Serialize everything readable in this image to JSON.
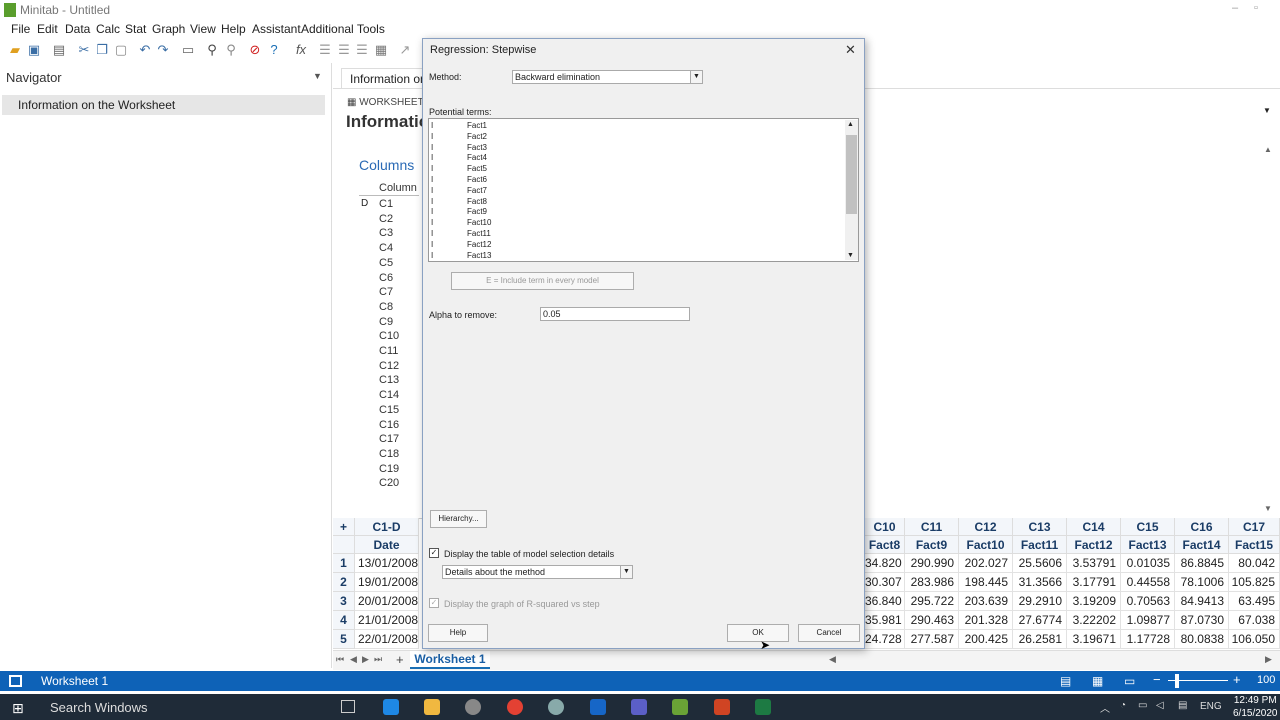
{
  "window": {
    "title": "Minitab - Untitled",
    "min": "–",
    "max": "▫"
  },
  "menu": [
    "File",
    "Edit",
    "Data",
    "Calc",
    "Stat",
    "Graph",
    "View",
    "Help",
    "Assistant",
    "Additional Tools"
  ],
  "navigator": {
    "title": "Navigator",
    "item": "Information on the Worksheet"
  },
  "info": {
    "tab": "Information on",
    "worksheet_label": "WORKSHEET 1",
    "title": "Informatio",
    "columns_heading": "Columns",
    "column_header": "Column",
    "d_flag": "D",
    "columns": [
      "C1",
      "C2",
      "C3",
      "C4",
      "C5",
      "C6",
      "C7",
      "C8",
      "C9",
      "C10",
      "C11",
      "C12",
      "C13",
      "C14",
      "C15",
      "C16",
      "C17",
      "C18",
      "C19",
      "C20"
    ]
  },
  "grid": {
    "left_col": {
      "id": "C1-D",
      "name": "Date",
      "values": [
        "13/01/2008",
        "19/01/2008",
        "20/01/2008",
        "21/01/2008",
        "22/01/2008"
      ]
    },
    "columns": [
      {
        "id": "C10",
        "name": "Fact8",
        "values": [
          "34.820",
          "30.307",
          "36.840",
          "35.981",
          "24.728"
        ]
      },
      {
        "id": "C11",
        "name": "Fact9",
        "values": [
          "290.990",
          "283.986",
          "295.722",
          "290.463",
          "277.587"
        ]
      },
      {
        "id": "C12",
        "name": "Fact10",
        "values": [
          "202.027",
          "198.445",
          "203.639",
          "201.328",
          "200.425"
        ]
      },
      {
        "id": "C13",
        "name": "Fact11",
        "values": [
          "25.5606",
          "31.3566",
          "29.2910",
          "27.6774",
          "26.2581"
        ]
      },
      {
        "id": "C14",
        "name": "Fact12",
        "values": [
          "3.53791",
          "3.17791",
          "3.19209",
          "3.22202",
          "3.19671"
        ]
      },
      {
        "id": "C15",
        "name": "Fact13",
        "values": [
          "0.01035",
          "0.44558",
          "0.70563",
          "1.09877",
          "1.17728"
        ]
      },
      {
        "id": "C16",
        "name": "Fact14",
        "values": [
          "86.8845",
          "78.1006",
          "84.9413",
          "87.0730",
          "80.0838"
        ]
      },
      {
        "id": "C17",
        "name": "Fact15",
        "values": [
          "80.042",
          "105.825",
          "63.495",
          "67.038",
          "106.050"
        ]
      }
    ],
    "row_numbers": [
      "1",
      "2",
      "3",
      "4",
      "5"
    ],
    "add_col": "+",
    "sheet_tab": "Worksheet 1",
    "add_sheet": "+"
  },
  "dialog": {
    "title": "Regression: Stepwise",
    "method_label": "Method:",
    "method_value": "Backward elimination",
    "potential_terms_label": "Potential terms:",
    "term_mark": "I",
    "terms": [
      "Fact1",
      "Fact2",
      "Fact3",
      "Fact4",
      "Fact5",
      "Fact6",
      "Fact7",
      "Fact8",
      "Fact9",
      "Fact10",
      "Fact11",
      "Fact12",
      "Fact13"
    ],
    "include_button": "E = Include term in every model",
    "alpha_label": "Alpha to remove:",
    "alpha_value": "0.05",
    "hierarchy_button": "Hierarchy...",
    "display_table_label": "Display the table of model selection details",
    "details_value": "Details about the method",
    "display_graph_label": "Display the graph of R-squared vs step",
    "help_button": "Help",
    "ok_button": "OK",
    "cancel_button": "Cancel"
  },
  "statusbar": {
    "label": "Worksheet 1",
    "zoom": "100"
  },
  "taskbar": {
    "search": "Search Windows",
    "lang": "ENG",
    "time": "12:49 PM",
    "date": "6/15/2020"
  },
  "colors": {
    "accent": "#0e62b7",
    "nav_selected": "#e6e6e6",
    "taskbar": "#1f2b38"
  }
}
